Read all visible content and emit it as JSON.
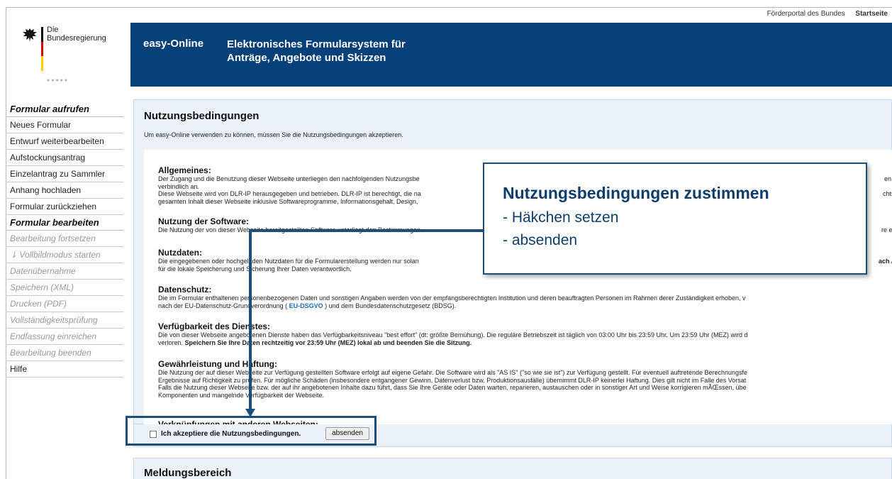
{
  "toplinks": {
    "portal": "Förderportal des Bundes",
    "start": "Startseite"
  },
  "logo": {
    "line1": "Die",
    "line2": "Bundesregierung",
    "dots": "●●●●●"
  },
  "header": {
    "brand": "easy-Online",
    "title_line1": "Elektronisches Formularsystem für",
    "title_line2": "Anträge, Angebote und Skizzen"
  },
  "sidebar": {
    "section1": "Formular aufrufen",
    "items1": [
      "Neues Formular",
      "Entwurf weiterbearbeiten",
      "Aufstockungsantrag",
      "Einzelantrag zu Sammler",
      "Anhang hochladen",
      "Formular zurückziehen"
    ],
    "section2": "Formular bearbeiten",
    "items2": [
      "Bearbeitung fortsetzen",
      "⇂ Vollbildmodus starten",
      "Datenübernahme",
      "Speichern (XML)",
      "Drucken (PDF)",
      "Vollständigkeitsprüfung",
      "Endfassung einreichen",
      "Bearbeitung beenden"
    ],
    "help": "Hilfe"
  },
  "main": {
    "title": "Nutzungsbedingungen",
    "intro": "Um easy-Online verwenden zu können, müssen Sie die Nutzungsbedingungen akzeptieren.",
    "sections": {
      "allgemeines": {
        "title": "Allgemeines:",
        "l1": "Der Zugang und die Benutzung dieser Webseite unterliegen den nachfolgenden Nutzungsbe",
        "l1b": "en Nu",
        "l2": "verbindlich an.",
        "l3": "Diese Webseite wird von DLR-IP herausgegeben und betrieben. DLR-IP ist berechtigt, die na",
        "l3b": "chtswir",
        "l4": "gesamten Inhalt dieser Webseite inklusive Softwareprogramme, Informationsgehalt, Design,"
      },
      "software": {
        "title": "Nutzung der Software:",
        "l1": "Die Nutzung der von dieser Webseite bereitgestellten Software unterliegt den Bestimmungen",
        "l1b": "re ein."
      },
      "nutzdaten": {
        "title": "Nutzdaten:",
        "l1": "Die eingegebenen oder hochgeladen Nutzdaten für die Formularerstellung werden nur solan",
        "l1b": "ach Ab",
        "l2": "für die lokale Speicherung und Sicherung Ihrer Daten verantwortlich."
      },
      "datenschutz": {
        "title": "Datenschutz:",
        "l1": "Die im Formular enthaltenen personenbezogenen Daten und sonstigen Angaben werden von der empfangsberechtigten Institution und deren beauftragten Personen im Rahmen derer Zuständigkeit erhoben, v",
        "l2a": "nach der EU-Datenschutz-Grundverordnung (",
        "l2link": "EU-DSGVO",
        "l2b": ") und dem Bundesdatenschutzgesetz (BDSG)."
      },
      "verfuegbarkeit": {
        "title": "Verfügbarkeit des Dienstes:",
        "l1": "Die von dieser Webseite angebotenen Dienste haben das Verfügbarkeitsniveau \"best effort\" (dt: größte Bemühung). Die reguläre Betriebszeit ist täglich von 03:00 Uhr bis 23:59 Uhr. Um 23:59 Uhr (MEZ) wird d",
        "l2a": "verloren.",
        "l2b": "Speichern Sie Ihre Daten rechtzeitig vor 23:59 Uhr (MEZ) lokal ab und beenden Sie die Sitzung."
      },
      "gewaehr": {
        "title": "Gewährleistung und Haftung:",
        "l1": "Die Nutzung der auf dieser Webseite zur Verfügung gestellten Software erfolgt auf eigene Gefahr. Die Software wird als \"AS IS\" (\"so wie sie ist\") zur Verfügung gestellt. Für eventuell auftretende Berechnungsfe",
        "l2": "Ergebnisse auf Richtigkeit zu prüfen. Für mögliche Schäden (insbesondere entgangener Gewinn, Datenverlust bzw. Produktionsausfälle) übernimmt DLR-IP keinerlei Haftung. Dies gilt nicht im Falle des Vorsat",
        "l3": "Falls die Nutzung dieser Webseite bzw. der auf ihr angebotenen Inhalte dazu führt, dass Sie Ihre Geräte oder Daten warten, reparieren, austauschen oder in sonstiger Art und Weise korrigieren mÃŒssen, übe",
        "l4": "Komponenten und mangelnde Verfügbarkeit der Webseite."
      },
      "verknuepfung": {
        "title": "Verknüpfungen mit anderen Webseiten:"
      }
    },
    "accept_label": "Ich akzeptiere die Nutzungsbedingungen.",
    "submit": "absenden",
    "meld_title": "Meldungsbereich"
  },
  "callout": {
    "title": "Nutzungsbedingungen zustimmen",
    "line1": "- Häkchen setzen",
    "line2": "- absenden"
  },
  "colors": {
    "header_blue": "#064079",
    "panel_bg": "#eaf1f8",
    "annotation_blue": "#1d4e79"
  }
}
